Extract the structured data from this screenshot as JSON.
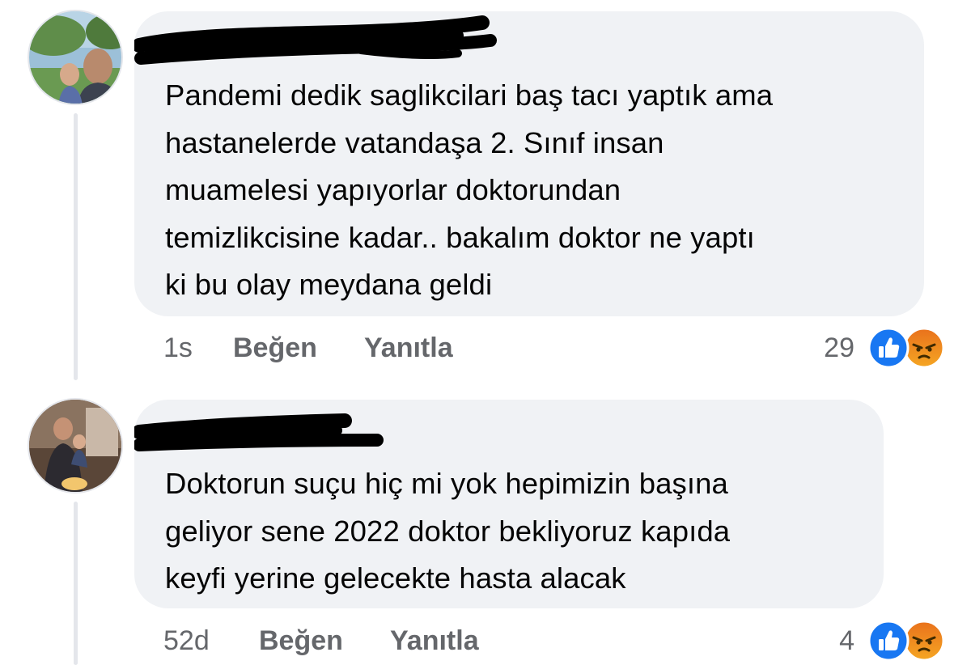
{
  "comments": [
    {
      "text_lines": [
        "Pandemi dedik saglikcilari baş tacı yaptık ama",
        "hastanelerde vatandaşa 2. Sınıf insan",
        "muamelesi yapıyorlar doktorundan",
        "temizlikcisine kadar.. bakalım doktor ne yaptı",
        "ki bu olay meydana geldi"
      ],
      "time": "1s",
      "like_label": "Beğen",
      "reply_label": "Yanıtla",
      "reaction_count": "29",
      "reactions": [
        "like-icon",
        "angry-icon"
      ]
    },
    {
      "text_lines": [
        "Doktorun suçu hiç mi yok hepimizin başına",
        "geliyor sene 2022 doktor bekliyoruz kapıda",
        "keyfi yerine gelecekte hasta alacak"
      ],
      "time": "52d",
      "like_label": "Beğen",
      "reply_label": "Yanıtla",
      "reaction_count": "4",
      "reactions": [
        "like-icon",
        "angry-icon"
      ]
    }
  ],
  "colors": {
    "bubble": "#f0f2f5",
    "text": "#050505",
    "meta": "#65676b",
    "like": "#1877f2",
    "angry_top": "#e9711c",
    "angry_bottom": "#f5a623",
    "redaction": "#000000"
  }
}
